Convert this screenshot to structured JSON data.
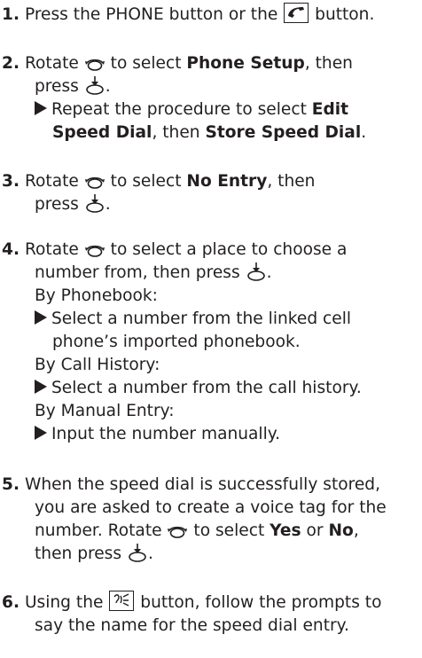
{
  "steps": [
    {
      "num": "1.",
      "a": "Press the PHONE button or the",
      "b": "button."
    },
    {
      "num": "2.",
      "a": "Rotate",
      "b": "to select",
      "bold1": "Phone Setup",
      "c": ", then",
      "d": "press",
      "e": ".",
      "note_a": "Repeat the procedure to select",
      "note_bold1": "Edit",
      "note_bold2": "Speed Dial",
      "note_b": ", then",
      "note_bold3": "Store Speed Dial",
      "note_c": "."
    },
    {
      "num": "3.",
      "a": "Rotate",
      "b": "to select",
      "bold1": "No Entry",
      "c": ", then",
      "d": "press",
      "e": "."
    },
    {
      "num": "4.",
      "a": "Rotate",
      "b": "to select a place to choose a",
      "c": "number from, then press",
      "d": ".",
      "opt1_label": "By Phonebook:",
      "opt1_line1": "Select a number from the linked cell",
      "opt1_line2": "phone’s imported phonebook.",
      "opt2_label": "By Call History:",
      "opt2_line1": "Select a number from the call history.",
      "opt3_label": "By Manual Entry:",
      "opt3_line1": "Input the number manually."
    },
    {
      "num": "5.",
      "line1": "When the speed dial is successfully stored,",
      "line2": "you are asked to create a voice tag for the",
      "line3a": "number. Rotate",
      "line3b": "to select",
      "bold1": "Yes",
      "line3c": "or",
      "bold2": "No",
      "line3d": ",",
      "line4a": "then press",
      "line4b": "."
    },
    {
      "num": "6.",
      "a": "Using the",
      "b": "button, follow the prompts to",
      "line2": "say the name for the speed dial entry."
    }
  ],
  "icons": {
    "phone_button": "phone-handset-icon",
    "rotate": "rotate-knob-icon",
    "press": "press-knob-icon",
    "talk_button": "talk-voice-icon"
  }
}
